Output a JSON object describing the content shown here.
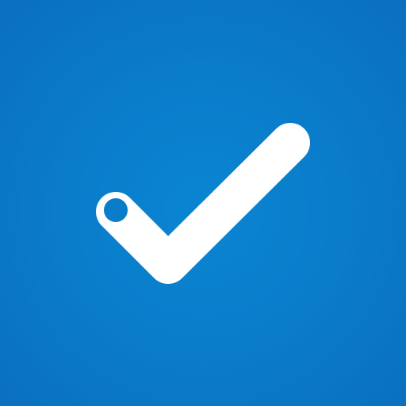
{
  "icon": {
    "name": "checkmark-icon",
    "background_color": "#0a7cc9",
    "check_color": "#ffffff",
    "dot_color": "#0a7cc9"
  }
}
